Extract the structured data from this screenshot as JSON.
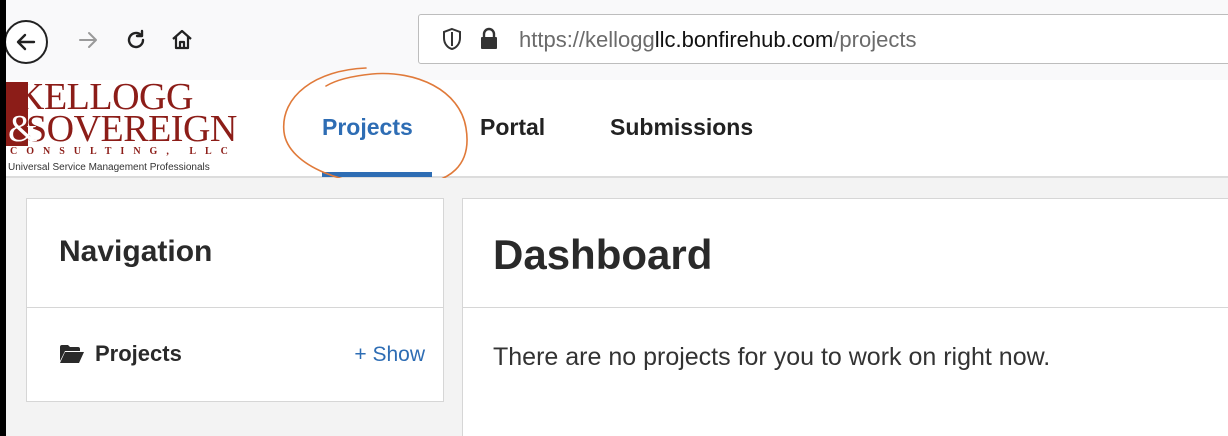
{
  "browser": {
    "url_prefix": "https://kellogg",
    "url_domain": "llc.bonfirehub.com",
    "url_path": "/projects"
  },
  "logo": {
    "line1": "KELLOGG",
    "line2": "SOVEREIGN",
    "ampersand": "&",
    "consulting": "CONSULTING, LLC",
    "tagline": "Universal Service Management Professionals"
  },
  "main_nav": {
    "projects": "Projects",
    "portal": "Portal",
    "submissions": "Submissions"
  },
  "sidebar": {
    "title": "Navigation",
    "projects_label": "Projects",
    "show_link": "+ Show"
  },
  "dashboard": {
    "title": "Dashboard",
    "message": "There are no projects for you to work on right now."
  },
  "colors": {
    "accent": "#2e6db4",
    "brand": "#8c1d18",
    "annotation": "#e07a3a"
  }
}
